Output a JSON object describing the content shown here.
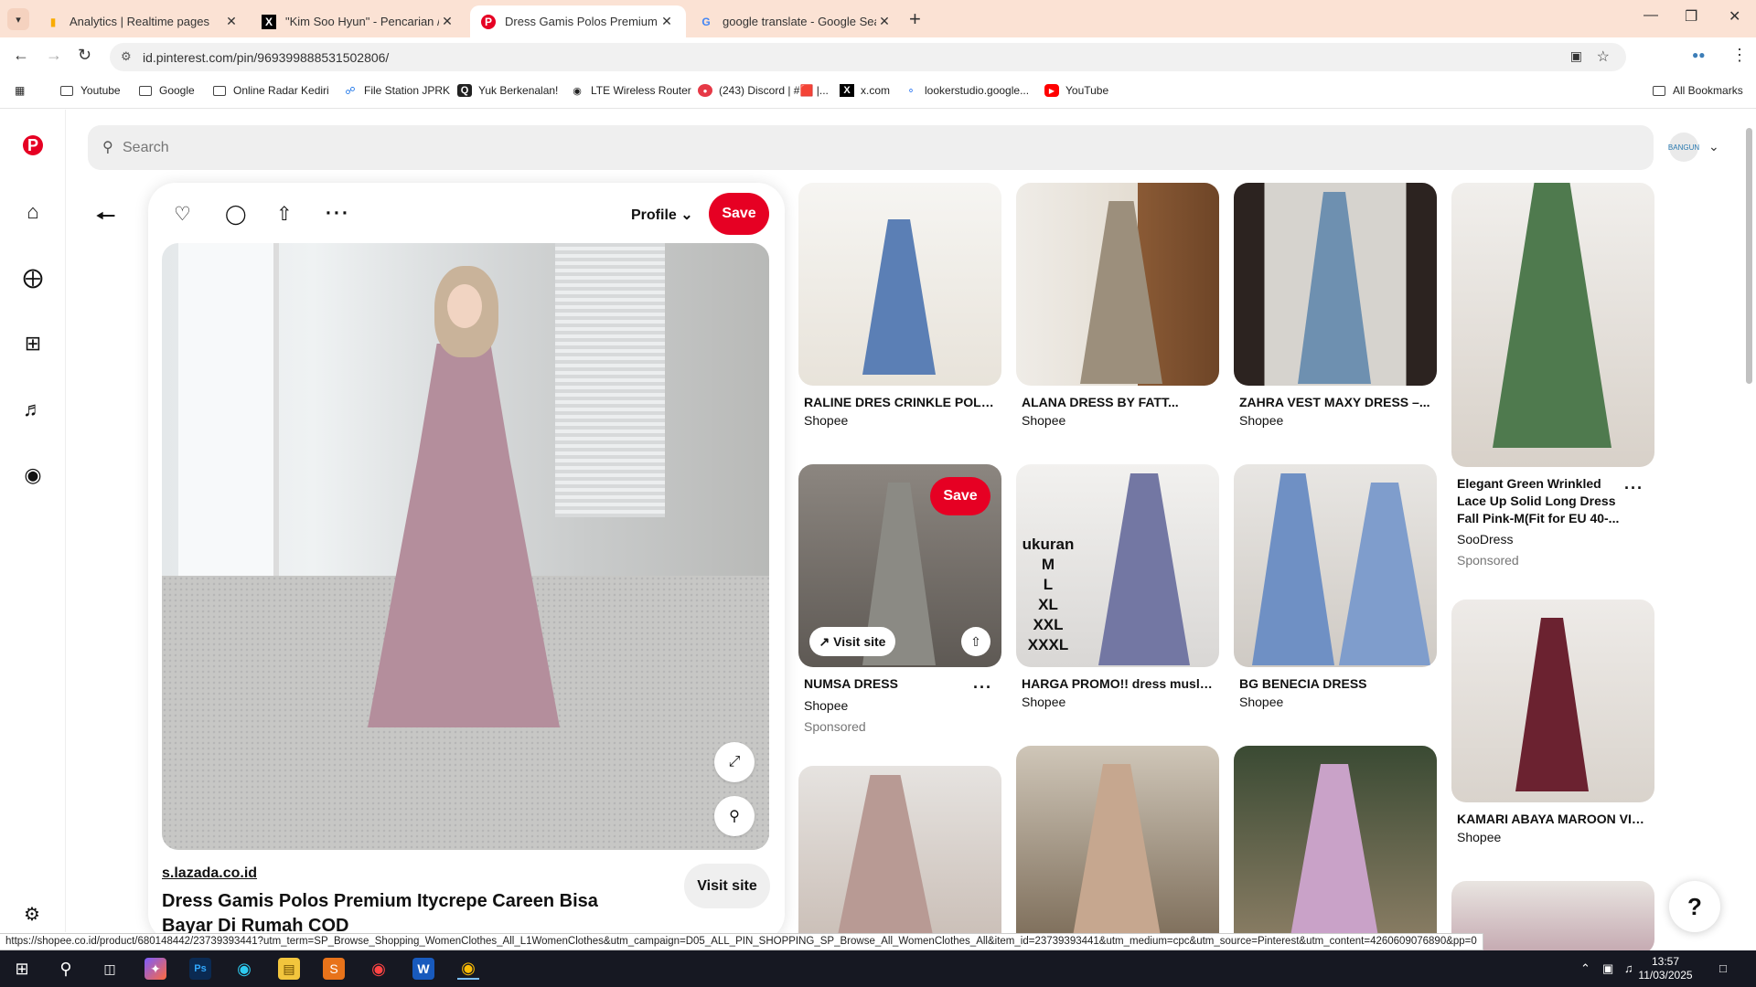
{
  "browser": {
    "tabs": [
      {
        "title": "Analytics | Realtime pages",
        "icon": "analytics-icon"
      },
      {
        "title": "\"Kim Soo Hyun\" - Pencarian / X",
        "icon": "x-icon"
      },
      {
        "title": "Dress Gamis Polos Premium Ity",
        "icon": "pinterest-icon"
      },
      {
        "title": "google translate - Google Sear",
        "icon": "google-icon"
      }
    ],
    "url": "id.pinterest.com/pin/969399888531502806/",
    "bookmarks": [
      "Youtube",
      "Google",
      "Online Radar Kediri",
      "File Station JPRK",
      "Yuk Berkenalan!",
      "LTE Wireless Router",
      "(243) Discord | #🟥 |...",
      "x.com",
      "lookerstudio.google...",
      "YouTube"
    ],
    "all_bookmarks": "All Bookmarks"
  },
  "search": {
    "placeholder": "Search"
  },
  "account": {
    "avatar_text": "BANGUN"
  },
  "pin": {
    "profile_label": "Profile",
    "save_label": "Save",
    "source": "s.lazada.co.id",
    "visit_label": "Visit site",
    "title": "Dress Gamis Polos Premium Itycrepe Careen Bisa Bayar Di Rumah COD"
  },
  "grid": {
    "col1": [
      {
        "title": "RALINE DRES CRINKLE POLOS...",
        "source": "Shopee"
      },
      {
        "title": "NUMSA DRESS",
        "source": "Shopee",
        "sponsored": "Sponsored",
        "save": "Save",
        "visit": "Visit site"
      }
    ],
    "col2": [
      {
        "title": "ALANA DRESS BY FATT...",
        "source": "Shopee"
      },
      {
        "title": "HARGA PROMO!! dress muslim...",
        "source": "Shopee",
        "overlay_text": "ukuran\nM\nL\nXL\nXXL\nXXXL"
      }
    ],
    "col3": [
      {
        "title": "ZAHRA VEST MAXY DRESS –...",
        "source": "Shopee"
      },
      {
        "title": "BG BENECIA DRESS",
        "source": "Shopee"
      }
    ],
    "col4": [
      {
        "title": "Elegant Green Wrinkled Lace Up Solid Long Dress Fall Pink-M(Fit for EU 40-...",
        "source": "SooDress",
        "sponsored": "Sponsored"
      },
      {
        "title": "KAMARI ABAYA MAROON VIR...",
        "source": "Shopee"
      }
    ]
  },
  "status_url": "https://shopee.co.id/product/680148442/23739393441?utm_term=SP_Browse_Shopping_WomenClothes_All_L1WomenClothes&utm_campaign=D05_ALL_PIN_SHOPPING_SP_Browse_All_WomenClothes_All&item_id=23739393441&utm_medium=cpc&utm_source=Pinterest&utm_content=4260609076890&pp=0",
  "taskbar": {
    "time": "13:57",
    "date": "11/03/2025"
  },
  "colors": {
    "accent": "#e60023",
    "tabstrip": "#fbe2d4"
  }
}
